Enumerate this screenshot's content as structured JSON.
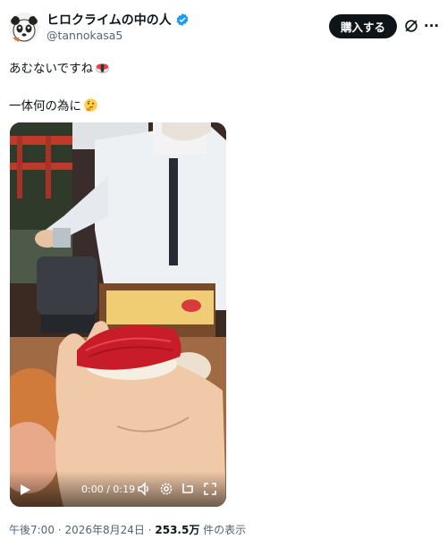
{
  "author": {
    "display_name": "ヒロクライムの中の人",
    "handle": "@tannokasa5",
    "avatar_icon": "panda-avatar-icon",
    "verified_icon": "verified-badge-icon"
  },
  "actions": {
    "buy_label": "購入する",
    "grok_icon": "grok-icon",
    "more_icon": "more-icon"
  },
  "tweet": {
    "line1": "あむないですね",
    "line1_emoji": "sushi-emoji",
    "line2": "一体何の為に",
    "line2_emoji": "thinking-face-emoji"
  },
  "video": {
    "time": "0:00 / 0:19",
    "icons": [
      "play-icon",
      "volume-icon",
      "settings-icon",
      "pip-icon",
      "fullscreen-icon"
    ]
  },
  "meta": {
    "time": "午後7:00",
    "date": "2026年8月24日",
    "views": "253.5万",
    "views_suffix": "件の表示",
    "separator": "·"
  },
  "colors": {
    "primary_text": "#0f1419",
    "secondary_text": "#536471",
    "verified": "#1d9bf0",
    "button_bg": "#0f1419"
  }
}
